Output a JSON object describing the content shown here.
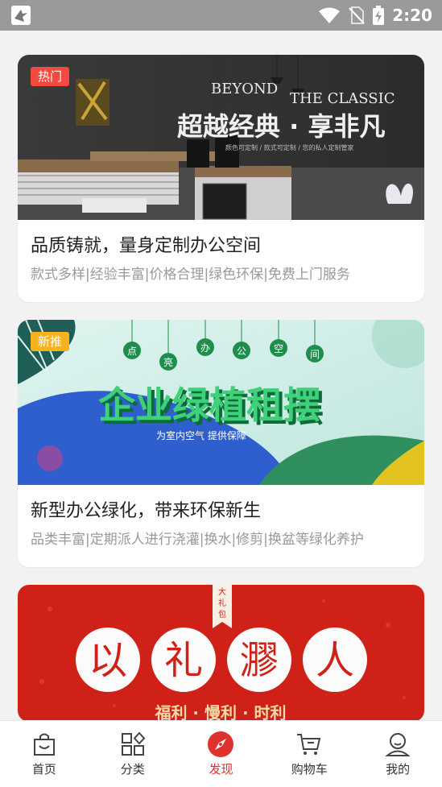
{
  "status_bar": {
    "time": "2:20"
  },
  "cards": [
    {
      "tag": "热门",
      "tag_color": "#f24a3e",
      "banner_text": {
        "en_line1": "BEYOND",
        "en_line2": "THE CLASSIC",
        "cn": "超越经典 · 享非凡",
        "small": "颜色可定制 / 款式可定制 / 您的私人定制管家"
      },
      "title": "品质铸就，量身定制办公空间",
      "subtitle": "款式多样|经验丰富|价格合理|绿色环保|免费上门服务"
    },
    {
      "tag": "新推",
      "tag_color": "#f5b21c",
      "banner_text": {
        "beads": [
          "点",
          "亮",
          "办",
          "公",
          "空",
          "间"
        ],
        "cn": "企业绿植租摆",
        "small": "为室内空气 提供保障"
      },
      "title": "新型办公绿化，带来环保新生",
      "subtitle": "品类丰富|定期派人进行浇灌|换水|修剪|换盆等绿化养护"
    },
    {
      "banner_text": {
        "ribbon": "大礼包",
        "chars": [
          "以",
          "礼",
          "㶀",
          "人"
        ],
        "bottom": "福利 · 慢利 · 时利"
      }
    }
  ],
  "bottom_nav": [
    {
      "label": "首页",
      "icon": "shopping-bag-icon",
      "active": false
    },
    {
      "label": "分类",
      "icon": "category-grid-icon",
      "active": false
    },
    {
      "label": "发现",
      "icon": "compass-icon",
      "active": true
    },
    {
      "label": "购物车",
      "icon": "cart-icon",
      "active": false
    },
    {
      "label": "我的",
      "icon": "user-icon",
      "active": false
    }
  ],
  "colors": {
    "accent": "#e0322c",
    "status_bar": "#9a9a9a",
    "background": "#f2f2f2"
  }
}
